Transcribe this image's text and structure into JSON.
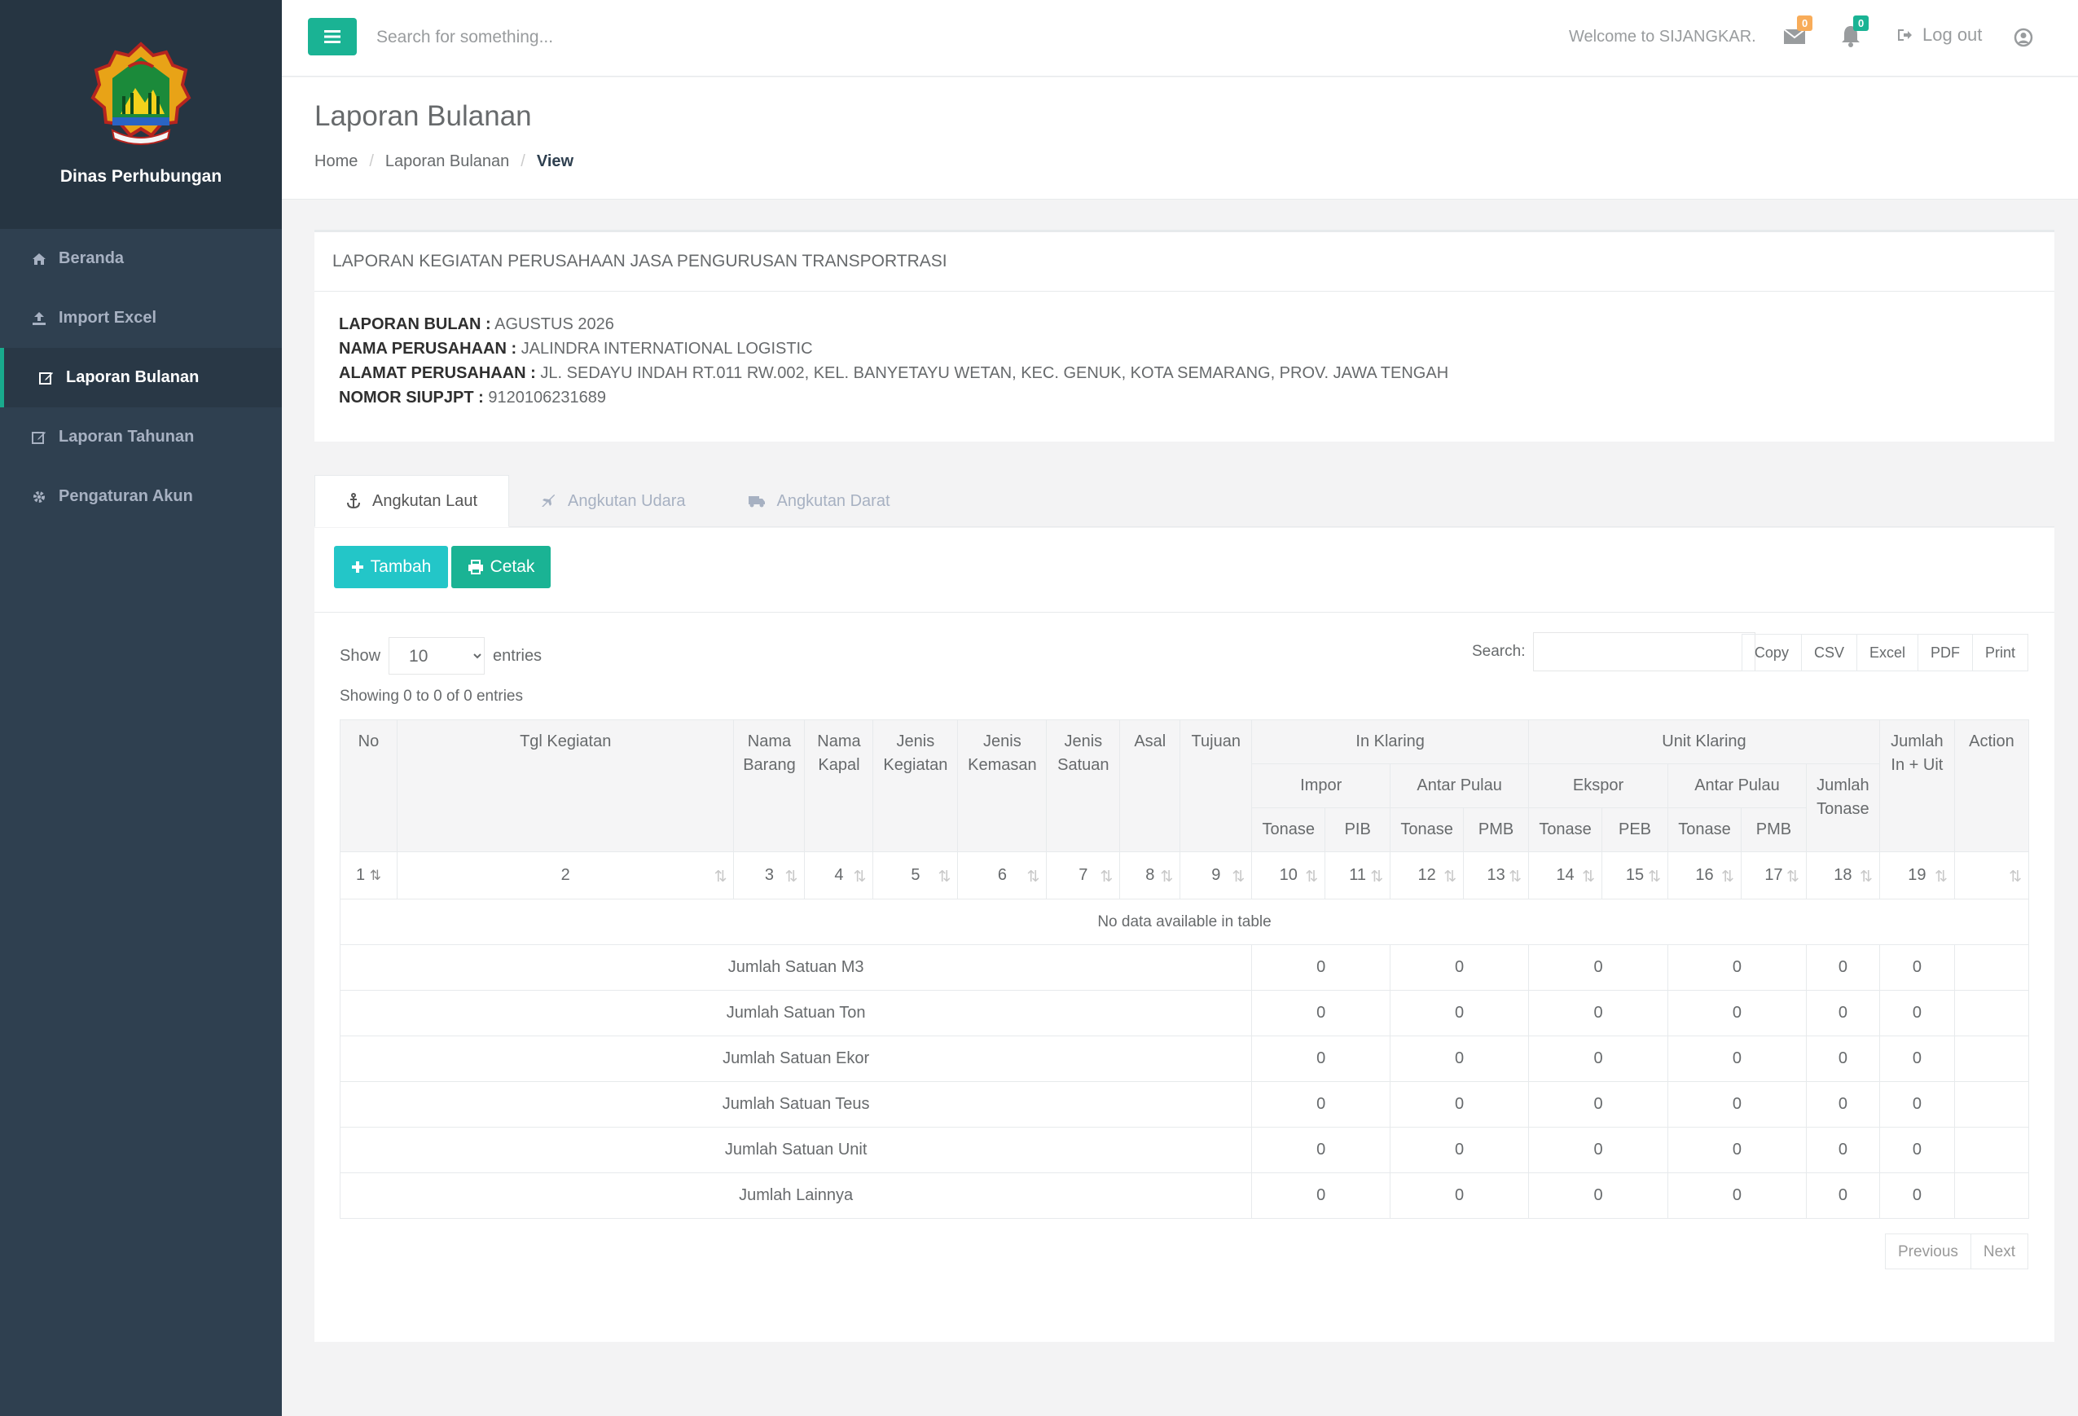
{
  "sidebar": {
    "brand": "Dinas Perhubungan",
    "items": [
      {
        "label": "Beranda",
        "icon": "home-icon"
      },
      {
        "label": "Import Excel",
        "icon": "upload-icon"
      },
      {
        "label": "Laporan Bulanan",
        "icon": "edit-icon",
        "active": true
      },
      {
        "label": "Laporan Tahunan",
        "icon": "edit-icon"
      },
      {
        "label": "Pengaturan Akun",
        "icon": "gear-icon"
      }
    ]
  },
  "topbar": {
    "search_placeholder": "Search for something...",
    "welcome": "Welcome to SIJANGKAR.",
    "messages_count": "0",
    "notifications_count": "0",
    "logout_label": "Log out"
  },
  "heading": {
    "title": "Laporan Bulanan",
    "breadcrumb": [
      "Home",
      "Laporan Bulanan",
      "View"
    ]
  },
  "info": {
    "title": "LAPORAN KEGIATAN PERUSAHAAN JASA PENGURUSAN TRANSPORTRASI",
    "rows": [
      {
        "label": "LAPORAN BULAN :",
        "value": "AGUSTUS 2026"
      },
      {
        "label": "NAMA PERUSAHAAN :",
        "value": "JALINDRA INTERNATIONAL LOGISTIC"
      },
      {
        "label": "ALAMAT PERUSAHAAN :",
        "value": "JL. SEDAYU INDAH RT.011 RW.002, KEL. BANYETAYU WETAN, KEC. GENUK, KOTA SEMARANG, PROV. JAWA TENGAH"
      },
      {
        "label": "NOMOR SIUPJPT :",
        "value": "9120106231689"
      }
    ]
  },
  "tabs": [
    {
      "label": "Angkutan Laut",
      "icon": "anchor-icon",
      "active": true
    },
    {
      "label": "Angkutan Udara",
      "icon": "plane-icon"
    },
    {
      "label": "Angkutan Darat",
      "icon": "truck-icon"
    }
  ],
  "toolbar": {
    "add_label": "Tambah",
    "print_label": "Cetak"
  },
  "datatable": {
    "show_label": "Show",
    "entries_label": "entries",
    "length_value": "10",
    "search_label": "Search:",
    "export_buttons": [
      "Copy",
      "CSV",
      "Excel",
      "PDF",
      "Print"
    ],
    "showing": "Showing 0 to 0 of 0 entries",
    "headers": {
      "no": "No",
      "tgl": "Tgl Kegiatan",
      "nama_barang": "Nama Barang",
      "nama_kapal": "Nama Kapal",
      "jenis_kegiatan": "Jenis Kegiatan",
      "jenis_kemasan": "Jenis Kemasan",
      "jenis_satuan": "Jenis Satuan",
      "asal": "Asal",
      "tujuan": "Tujuan",
      "in_klaring": "In Klaring",
      "unit_klaring": "Unit Klaring",
      "jumlah_in_uit": "Jumlah In + Uit",
      "action": "Action",
      "impor": "Impor",
      "antar_pulau": "Antar Pulau",
      "ekspor": "Ekspor",
      "jumlah_tonase": "Jumlah Tonase",
      "tonase": "Tonase",
      "pib": "PIB",
      "pmb": "PMB",
      "peb": "PEB"
    },
    "index_row": [
      "1",
      "2",
      "3",
      "4",
      "5",
      "6",
      "7",
      "8",
      "9",
      "10",
      "11",
      "12",
      "13",
      "14",
      "15",
      "16",
      "17",
      "18",
      "19",
      ""
    ],
    "empty_message": "No data available in table",
    "summary_rows": [
      {
        "label": "Jumlah Satuan M3",
        "values": [
          "0",
          "0",
          "0",
          "0",
          "0",
          "0"
        ]
      },
      {
        "label": "Jumlah Satuan Ton",
        "values": [
          "0",
          "0",
          "0",
          "0",
          "0",
          "0"
        ]
      },
      {
        "label": "Jumlah Satuan Ekor",
        "values": [
          "0",
          "0",
          "0",
          "0",
          "0",
          "0"
        ]
      },
      {
        "label": "Jumlah Satuan Teus",
        "values": [
          "0",
          "0",
          "0",
          "0",
          "0",
          "0"
        ]
      },
      {
        "label": "Jumlah Satuan Unit",
        "values": [
          "0",
          "0",
          "0",
          "0",
          "0",
          "0"
        ]
      },
      {
        "label": "Jumlah Lainnya",
        "values": [
          "0",
          "0",
          "0",
          "0",
          "0",
          "0"
        ]
      }
    ],
    "previous_label": "Previous",
    "next_label": "Next"
  },
  "colors": {
    "sidebar": "#2f4050",
    "primary": "#1ab394",
    "info": "#23c6c8",
    "warning": "#f8ac59"
  }
}
